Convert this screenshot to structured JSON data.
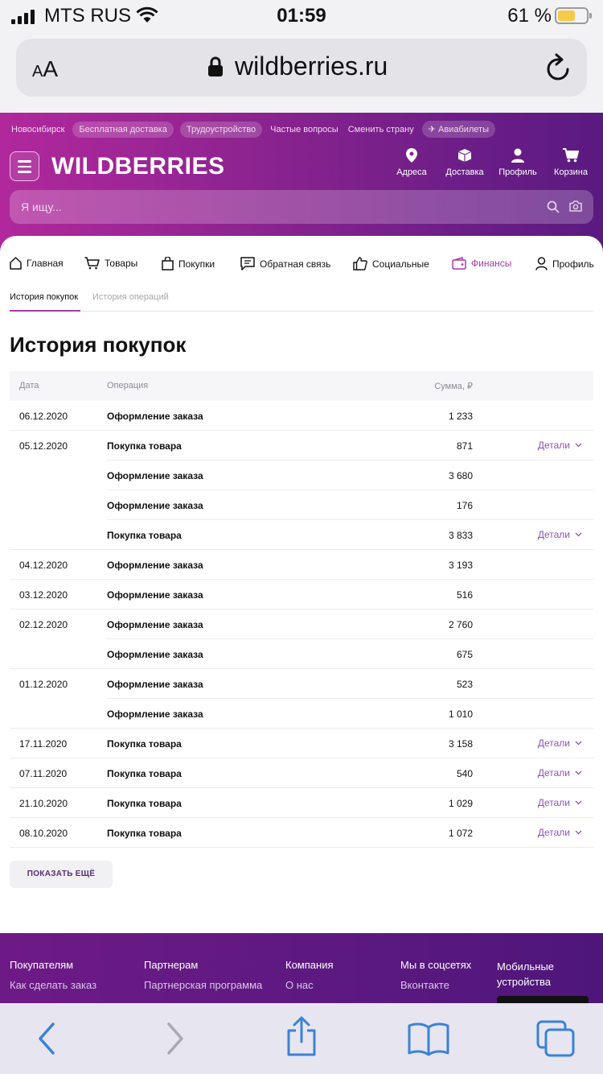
{
  "status_bar": {
    "carrier": "MTS RUS",
    "time": "01:59",
    "battery_percent": "61 %",
    "battery_level": 0.61,
    "battery_color": "#f7c948"
  },
  "browser": {
    "text_size_small": "A",
    "text_size_large": "A",
    "url": "wildberries.ru"
  },
  "header": {
    "city": "Новосибирск",
    "links": [
      "Бесплатная доставка",
      "Трудоустройство",
      "Частые вопросы",
      "Сменить страну",
      "Авиабилеты"
    ],
    "logo": "WILDBERRIES",
    "icons": [
      {
        "name": "location-icon",
        "label": "Адреса"
      },
      {
        "name": "box-icon",
        "label": "Доставка"
      },
      {
        "name": "person-icon",
        "label": "Профиль"
      },
      {
        "name": "cart-icon",
        "label": "Корзина"
      }
    ],
    "search_placeholder": "Я ищу...",
    "gradient": [
      "#b1289c",
      "#5a1a80"
    ]
  },
  "account_tabs": [
    {
      "name": "home-icon",
      "label": "Главная"
    },
    {
      "name": "cart-icon",
      "label": "Товары"
    },
    {
      "name": "bag-icon",
      "label": "Покупки"
    },
    {
      "name": "feedback-icon",
      "label": "Обратная связь"
    },
    {
      "name": "thumbs-up-icon",
      "label": "Социальные"
    },
    {
      "name": "wallet-icon",
      "label": "Финансы",
      "active": true
    },
    {
      "name": "person-icon",
      "label": "Профиль"
    }
  ],
  "accent_color": "#a73aaa",
  "subtabs": [
    "История покупок",
    "История операций"
  ],
  "page_title": "История покупок",
  "table": {
    "columns": [
      "Дата",
      "Операция",
      "Сумма, ₽"
    ],
    "details_label": "Детали",
    "rows": [
      {
        "date": "06.12.2020",
        "op": "Оформление заказа",
        "sum": "1 233",
        "details": false,
        "group_end": true
      },
      {
        "date": "05.12.2020",
        "op": "Покупка товара",
        "sum": "871",
        "details": true,
        "group_end": false
      },
      {
        "date": "",
        "op": "Оформление заказа",
        "sum": "3 680",
        "details": false,
        "group_end": false
      },
      {
        "date": "",
        "op": "Оформление заказа",
        "sum": "176",
        "details": false,
        "group_end": false
      },
      {
        "date": "",
        "op": "Покупка товара",
        "sum": "3 833",
        "details": true,
        "group_end": true
      },
      {
        "date": "04.12.2020",
        "op": "Оформление заказа",
        "sum": "3 193",
        "details": false,
        "group_end": true
      },
      {
        "date": "03.12.2020",
        "op": "Оформление заказа",
        "sum": "516",
        "details": false,
        "group_end": true
      },
      {
        "date": "02.12.2020",
        "op": "Оформление заказа",
        "sum": "2 760",
        "details": false,
        "group_end": false
      },
      {
        "date": "",
        "op": "Оформление заказа",
        "sum": "675",
        "details": false,
        "group_end": true
      },
      {
        "date": "01.12.2020",
        "op": "Оформление заказа",
        "sum": "523",
        "details": false,
        "group_end": false
      },
      {
        "date": "",
        "op": "Оформление заказа",
        "sum": "1 010",
        "details": false,
        "group_end": true
      },
      {
        "date": "17.11.2020",
        "op": "Покупка товара",
        "sum": "3 158",
        "details": true,
        "group_end": true
      },
      {
        "date": "07.11.2020",
        "op": "Покупка товара",
        "sum": "540",
        "details": true,
        "group_end": true
      },
      {
        "date": "21.10.2020",
        "op": "Покупка товара",
        "sum": "1 029",
        "details": true,
        "group_end": true
      },
      {
        "date": "08.10.2020",
        "op": "Покупка товара",
        "sum": "1 072",
        "details": true,
        "group_end": true
      }
    ]
  },
  "show_more": "ПОКАЗАТЬ ЕЩЁ",
  "footer": {
    "columns": [
      {
        "heading": "Покупателям",
        "link": "Как сделать заказ"
      },
      {
        "heading": "Партнерам",
        "link": "Партнерская программа"
      },
      {
        "heading": "Компания",
        "link": "О нас"
      },
      {
        "heading": "Мы в соцсетях",
        "link": "Вконтакте"
      },
      {
        "heading": "Мобильные устройства",
        "link": ""
      }
    ]
  },
  "browser_toolbar": [
    "back-icon",
    "forward-icon",
    "share-icon",
    "bookmarks-icon",
    "tabs-icon"
  ]
}
